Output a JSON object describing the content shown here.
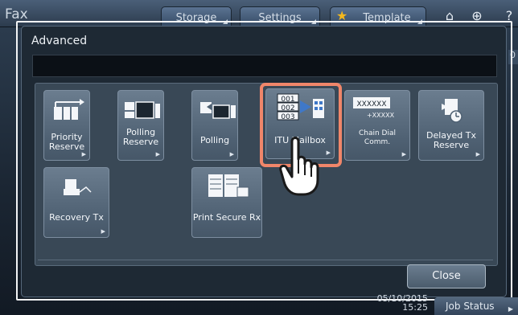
{
  "top_bar": {
    "app_title": "Fax",
    "tabs": [
      {
        "label": "Storage"
      },
      {
        "label": "Settings"
      },
      {
        "label": "Template"
      }
    ],
    "home_icon": "home-icon",
    "globe_icon": "globe-icon",
    "help_label": "?",
    "right_stub": "0"
  },
  "dialog": {
    "title": "Advanced",
    "info_text": "",
    "buttons": [
      {
        "label": "Priority Reserve",
        "icon": "priority-reserve-icon"
      },
      {
        "label": "Polling Reserve",
        "icon": "polling-reserve-icon"
      },
      {
        "label": "Polling",
        "icon": "polling-icon"
      },
      {
        "label": "ITU Mailbox",
        "icon": "itu-mailbox-icon",
        "icon_text": [
          "001",
          "002",
          "003"
        ],
        "selected": true
      },
      {
        "label": "Chain Dial Comm.",
        "icon": "chain-dial-icon",
        "icon_text": [
          "XXXXXX",
          "+XXXXX"
        ]
      },
      {
        "label": "Delayed Tx Reserve",
        "icon": "delayed-tx-icon"
      },
      {
        "label": "Recovery Tx",
        "icon": "recovery-tx-icon"
      },
      {
        "label": "Print Secure Rx",
        "icon": "print-secure-rx-icon"
      }
    ],
    "close_label": "Close"
  },
  "status_bar": {
    "date": "05/10/2015",
    "time": "15:25",
    "job_status_label": "Job Status"
  },
  "colors": {
    "highlight": "#f0866a",
    "accent_star": "#f4b81c"
  }
}
